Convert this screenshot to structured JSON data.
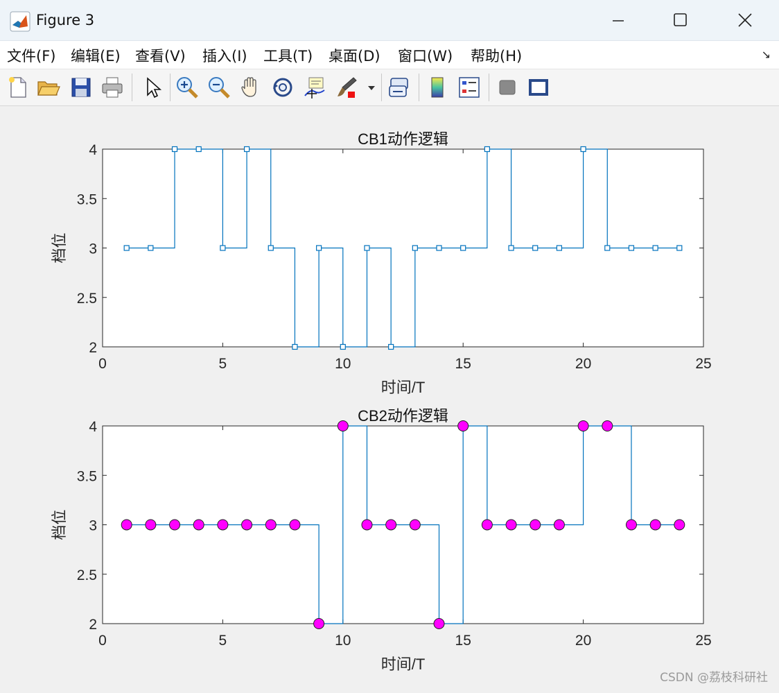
{
  "window": {
    "title": "Figure 3"
  },
  "menu": [
    "文件(F)",
    "编辑(E)",
    "查看(V)",
    "插入(I)",
    "工具(T)",
    "桌面(D)",
    "窗口(W)",
    "帮助(H)"
  ],
  "toolbar": {
    "tools": [
      "new-figure",
      "open-file",
      "save",
      "print",
      "select-arrow",
      "zoom-in",
      "zoom-out",
      "pan",
      "rotate-3d",
      "data-cursor",
      "brush",
      "link-plot",
      "colorbar",
      "legend",
      "hide-plot-tools",
      "show-plot-tools"
    ]
  },
  "watermark": "CSDN @荔枝科研社",
  "chart_data": [
    {
      "type": "line",
      "title": "CB1动作逻辑",
      "xlabel": "时间/T",
      "ylabel": "档位",
      "xlim": [
        0,
        25
      ],
      "ylim": [
        2,
        4
      ],
      "xticks": [
        0,
        5,
        10,
        15,
        20,
        25
      ],
      "yticks": [
        2,
        2.5,
        3,
        3.5,
        4
      ],
      "marker": "square",
      "line_color": "#0072bd",
      "marker_color": "#0072bd",
      "x": [
        1,
        2,
        3,
        4,
        5,
        6,
        7,
        8,
        9,
        10,
        11,
        12,
        13,
        14,
        15,
        16,
        17,
        18,
        19,
        20,
        21,
        22,
        23,
        24
      ],
      "values": [
        3,
        3,
        4,
        4,
        3,
        4,
        3,
        2,
        3,
        2,
        3,
        2,
        3,
        3,
        3,
        4,
        3,
        3,
        3,
        4,
        3,
        3,
        3,
        3
      ]
    },
    {
      "type": "line",
      "title": "CB2动作逻辑",
      "xlabel": "时间/T",
      "ylabel": "档位",
      "xlim": [
        0,
        25
      ],
      "ylim": [
        2,
        4
      ],
      "xticks": [
        0,
        5,
        10,
        15,
        20,
        25
      ],
      "yticks": [
        2,
        2.5,
        3,
        3.5,
        4
      ],
      "marker": "circle",
      "line_color": "#0072bd",
      "marker_color": "#ff00ff",
      "x": [
        1,
        2,
        3,
        4,
        5,
        6,
        7,
        8,
        9,
        10,
        11,
        12,
        13,
        14,
        15,
        16,
        17,
        18,
        19,
        20,
        21,
        22,
        23,
        24
      ],
      "values": [
        3,
        3,
        3,
        3,
        3,
        3,
        3,
        3,
        2,
        4,
        3,
        3,
        3,
        2,
        4,
        3,
        3,
        3,
        3,
        4,
        4,
        3,
        3,
        3
      ]
    }
  ]
}
